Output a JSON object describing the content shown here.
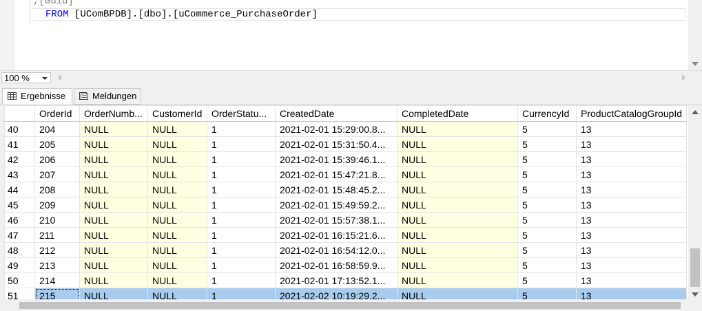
{
  "editor": {
    "line1": ",[Guid]",
    "line2_keyword": "FROM",
    "line2_rest": " [UComBPDB].[dbo].[uCommerce_PurchaseOrder]"
  },
  "zoom": {
    "value": "100 %"
  },
  "tabs": [
    {
      "label": "Ergebnisse",
      "icon": "grid-icon",
      "active": true
    },
    {
      "label": "Meldungen",
      "icon": "messages-icon",
      "active": false
    }
  ],
  "grid": {
    "columns": [
      "OrderId",
      "OrderNumb...",
      "CustomerId",
      "OrderStatu...",
      "CreatedDate",
      "CompletedDate",
      "CurrencyId",
      "ProductCatalogGroupId"
    ],
    "rows": [
      {
        "num": "40",
        "cells": [
          "204",
          "NULL",
          "NULL",
          "1",
          "2021-02-01 15:29:00.8...",
          "NULL",
          "5",
          "13"
        ]
      },
      {
        "num": "41",
        "cells": [
          "205",
          "NULL",
          "NULL",
          "1",
          "2021-02-01 15:31:50.4...",
          "NULL",
          "5",
          "13"
        ]
      },
      {
        "num": "42",
        "cells": [
          "206",
          "NULL",
          "NULL",
          "1",
          "2021-02-01 15:39:46.1...",
          "NULL",
          "5",
          "13"
        ]
      },
      {
        "num": "43",
        "cells": [
          "207",
          "NULL",
          "NULL",
          "1",
          "2021-02-01 15:47:21.8...",
          "NULL",
          "5",
          "13"
        ]
      },
      {
        "num": "44",
        "cells": [
          "208",
          "NULL",
          "NULL",
          "1",
          "2021-02-01 15:48:45.2...",
          "NULL",
          "5",
          "13"
        ]
      },
      {
        "num": "45",
        "cells": [
          "209",
          "NULL",
          "NULL",
          "1",
          "2021-02-01 15:49:59.2...",
          "NULL",
          "5",
          "13"
        ]
      },
      {
        "num": "46",
        "cells": [
          "210",
          "NULL",
          "NULL",
          "1",
          "2021-02-01 15:57:38.1...",
          "NULL",
          "5",
          "13"
        ]
      },
      {
        "num": "47",
        "cells": [
          "211",
          "NULL",
          "NULL",
          "1",
          "2021-02-01 16:15:21.6...",
          "NULL",
          "5",
          "13"
        ]
      },
      {
        "num": "48",
        "cells": [
          "212",
          "NULL",
          "NULL",
          "1",
          "2021-02-01 16:54:12.0...",
          "NULL",
          "5",
          "13"
        ]
      },
      {
        "num": "49",
        "cells": [
          "213",
          "NULL",
          "NULL",
          "1",
          "2021-02-01 16:58:59.9...",
          "NULL",
          "5",
          "13"
        ]
      },
      {
        "num": "50",
        "cells": [
          "214",
          "NULL",
          "NULL",
          "1",
          "2021-02-01 17:13:52.1...",
          "NULL",
          "5",
          "13"
        ]
      },
      {
        "num": "51",
        "cells": [
          "215",
          "NULL",
          "NULL",
          "1",
          "2021-02-02 10:19:29.2...",
          "NULL",
          "5",
          "13"
        ],
        "selected": true
      }
    ]
  },
  "colors": {
    "null_bg": "#ffffe1",
    "selected_bg": "#a8ccee",
    "keyword": "#0000ff"
  }
}
